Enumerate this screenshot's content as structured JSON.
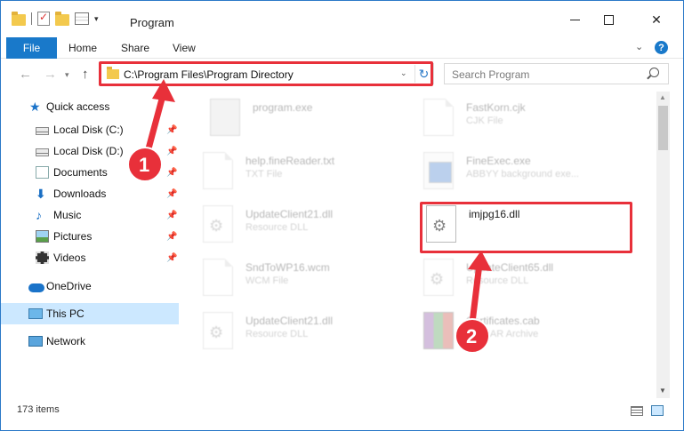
{
  "window": {
    "title": "Program",
    "minimize_label": "",
    "maximize_label": "",
    "close_label": "✕"
  },
  "ribbon": {
    "tabs": [
      "File",
      "Home",
      "Share",
      "View"
    ],
    "help": "?"
  },
  "nav": {
    "address": "C:\\Program Files\\Program Directory",
    "search_placeholder": "Search Program"
  },
  "sidebar": {
    "items": [
      {
        "label": "Quick access",
        "icon": "star-icon",
        "pinned": false
      },
      {
        "label": "Local Disk (C:)",
        "icon": "disk-icon",
        "pinned": true
      },
      {
        "label": "Local Disk (D:)",
        "icon": "disk-icon",
        "pinned": true
      },
      {
        "label": "Documents",
        "icon": "documents-icon",
        "pinned": true
      },
      {
        "label": "Downloads",
        "icon": "downloads-icon",
        "pinned": true
      },
      {
        "label": "Music",
        "icon": "music-icon",
        "pinned": true
      },
      {
        "label": "Pictures",
        "icon": "pictures-icon",
        "pinned": true
      },
      {
        "label": "Videos",
        "icon": "videos-icon",
        "pinned": true
      },
      {
        "label": "OneDrive",
        "icon": "onedrive-icon",
        "pinned": false
      },
      {
        "label": "This PC",
        "icon": "this-pc-icon",
        "pinned": false,
        "selected": true
      },
      {
        "label": "Network",
        "icon": "network-icon",
        "pinned": false
      }
    ]
  },
  "files": [
    {
      "name": "program.exe",
      "type": ""
    },
    {
      "name": "FastKorn.cjk",
      "type": "CJK File"
    },
    {
      "name": "help.fineReader.txt",
      "type": "TXT File"
    },
    {
      "name": "FineExec.exe",
      "type": "ABBYY background exe..."
    },
    {
      "name": "UpdateClient21.dll",
      "type": "Resource DLL"
    },
    {
      "name": "imjpg16.dll",
      "type": ""
    },
    {
      "name": "SndToWP16.wcm",
      "type": "WCM File"
    },
    {
      "name": "UpdateClient65.dll",
      "type": "Resource DLL"
    },
    {
      "name": "UpdateClient21.dll",
      "type": "Resource DLL"
    },
    {
      "name": "Certificates.cab",
      "type": "WinRAR Archive"
    }
  ],
  "status": {
    "count": "173 items"
  },
  "annotations": {
    "step1": "1",
    "step2": "2",
    "color": "#e8303a"
  }
}
